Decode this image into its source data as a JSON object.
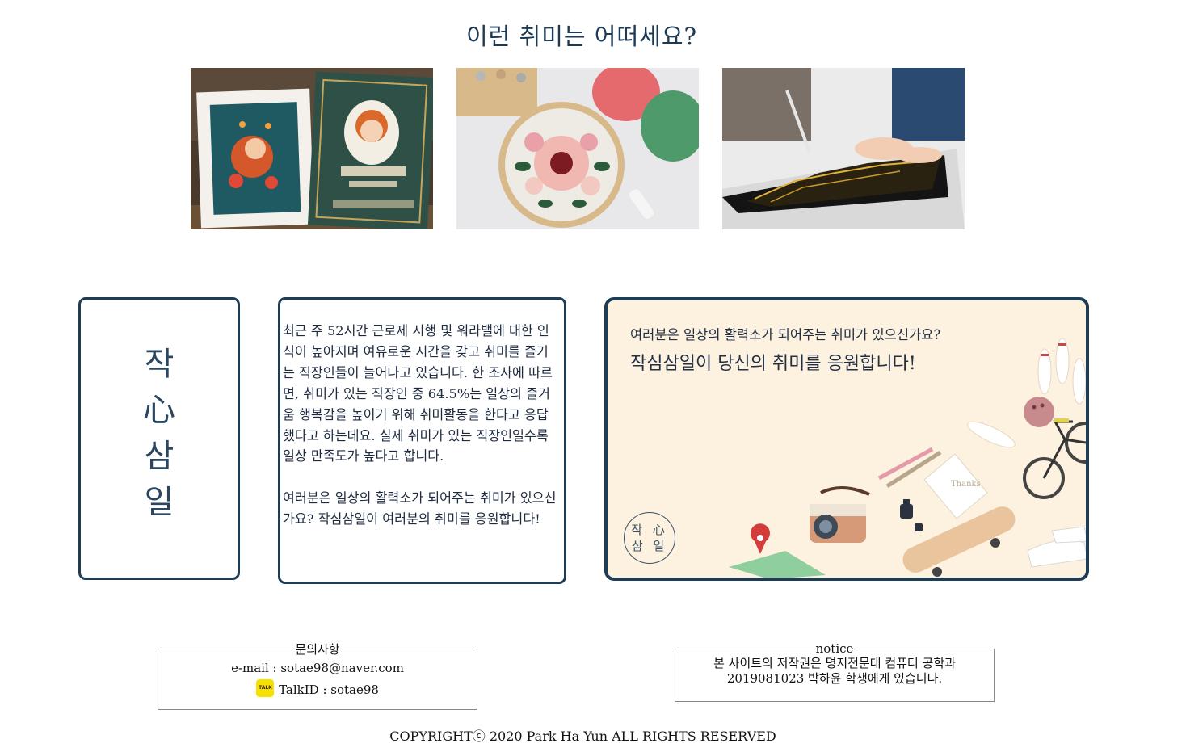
{
  "heading": "이런 취미는 어떠세요?",
  "photos": [
    {
      "name": "anne-green-gables-gem-painting",
      "icon": "photo"
    },
    {
      "name": "punch-needle-embroidery-hoop",
      "icon": "photo"
    },
    {
      "name": "scratch-night-view-drawing",
      "icon": "photo"
    }
  ],
  "brand": {
    "line1": "작",
    "line2": "心",
    "line3": "삼",
    "line4": "일"
  },
  "intro": {
    "paragraph1": "최근 주 52시간 근로제 시행 및 워라밸에 대한 인식이 높아지며 여유로운 시간을 갖고 취미를 즐기는 직장인들이 늘어나고 있습니다. 한 조사에 따르면, 취미가 있는 직장인 중 64.5%는 일상의 즐거움 행복감을 높이기 위해 취미활동을 한다고 응답했다고 하는데요. 실제 취미가 있는 직장인일수록 일상 만족도가 높다고 합니다.",
    "paragraph2": "여러분은 일상의 활력소가 되어주는 취미가 있으신가요? 작심삼일이 여러분의 취미를 응원합니다!"
  },
  "banner": {
    "subtitle": "여러분은 일상의 활력소가 되어주는 취미가 있으신가요?",
    "title": "작심삼일이 당신의 취미를 응원합니다!",
    "seal_line1": "작 心",
    "seal_line2": "삼 일",
    "card_text": "Thanks"
  },
  "contact": {
    "legend": "문의사항",
    "email": "e-mail : sotae98@naver.com",
    "kakao_badge": "TALK",
    "talk": "TalkID : sotae98"
  },
  "notice": {
    "legend": "notice",
    "line1": "본 사이트의 저작권은 명지전문대 컴퓨터 공학과",
    "line2": "2019081023 박하윤 학생에게 있습니다."
  },
  "copyright": "COPYRIGHTⓒ 2020 Park Ha Yun ALL RIGHTS RESERVED",
  "colors": {
    "accent": "#1e3d55",
    "banner_bg": "#fdf1df",
    "kakao": "#f7e100"
  }
}
